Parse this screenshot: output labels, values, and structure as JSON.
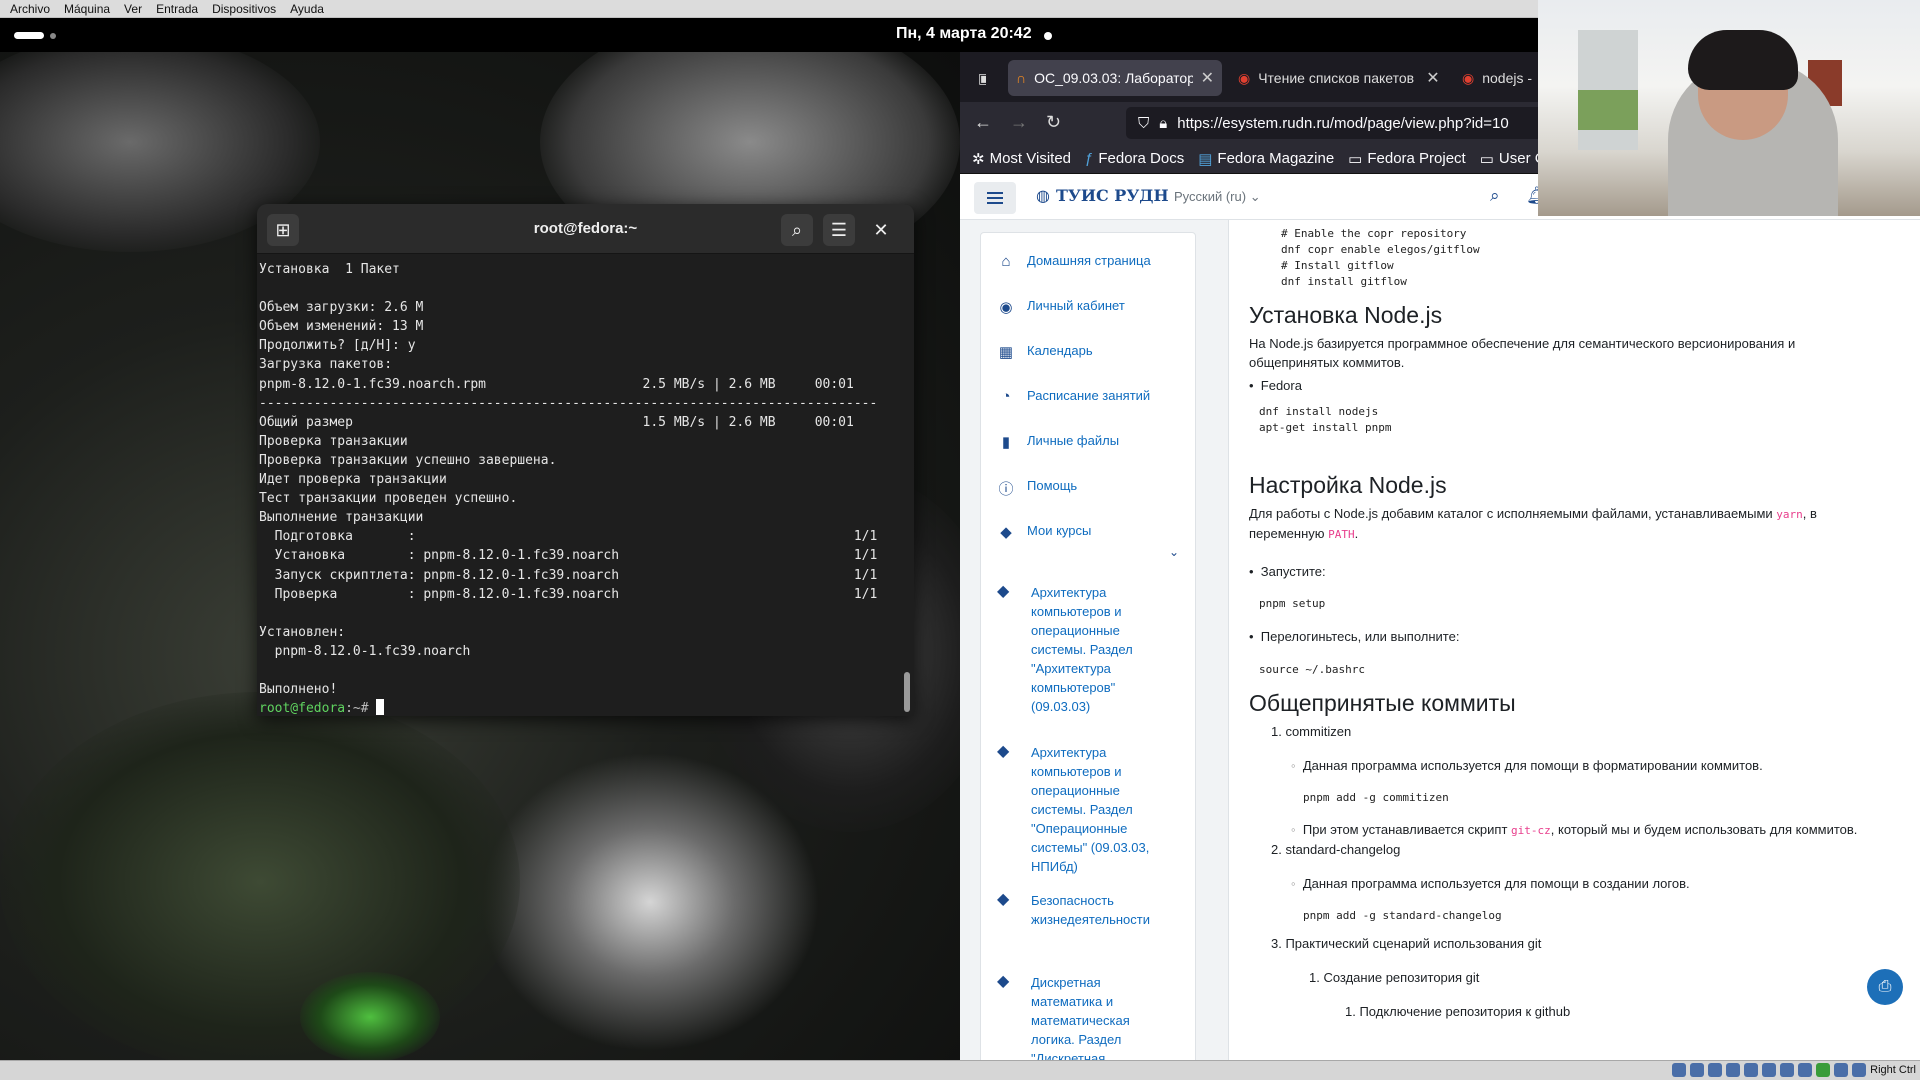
{
  "host_menu": [
    "Archivo",
    "Máquina",
    "Ver",
    "Entrada",
    "Dispositivos",
    "Ayuda"
  ],
  "topbar": {
    "clock": "Пн, 4 марта  20:42"
  },
  "terminal": {
    "title": "root@fedora:~",
    "lines": [
      "Установка  1 Пакет",
      "",
      "Объем загрузки: 2.6 M",
      "Объем изменений: 13 M",
      "Продолжить? [д/Н]: y",
      "Загрузка пакетов:",
      "pnpm-8.12.0-1.fc39.noarch.rpm                    2.5 MB/s | 2.6 MB     00:01",
      "-------------------------------------------------------------------------------",
      "Общий размер                                     1.5 MB/s | 2.6 MB     00:01",
      "Проверка транзакции",
      "Проверка транзакции успешно завершена.",
      "Идет проверка транзакции",
      "Тест транзакции проведен успешно.",
      "Выполнение транзакции",
      "  Подготовка       :                                                        1/1",
      "  Установка        : pnpm-8.12.0-1.fc39.noarch                              1/1",
      "  Запуск скриптлета: pnpm-8.12.0-1.fc39.noarch                              1/1",
      "  Проверка         : pnpm-8.12.0-1.fc39.noarch                              1/1",
      "",
      "Установлен:",
      "  pnpm-8.12.0-1.fc39.noarch",
      "",
      "Выполнено!"
    ],
    "prompt_user": "root@fedora",
    "prompt_rest": ":~# "
  },
  "browser": {
    "tabs": [
      "ОС_09.03.03: Лаборатор",
      "Чтение списков пакетов",
      "nodejs -"
    ],
    "url": "https://esystem.rudn.ru/mod/page/view.php?id=10",
    "bookmarks": [
      "Most Visited",
      "Fedora Docs",
      "Fedora Magazine",
      "Fedora Project",
      "User Co"
    ]
  },
  "site": {
    "brand": "ТУИС РУДН",
    "lang": "Русский (ru)",
    "sidebar": [
      {
        "label": "Домашняя страница",
        "icon": "home-icon"
      },
      {
        "label": "Личный кабинет",
        "icon": "user-icon"
      },
      {
        "label": "Календарь",
        "icon": "calendar-icon"
      },
      {
        "label": "Расписание занятий",
        "icon": "clock-icon"
      },
      {
        "label": "Личные файлы",
        "icon": "file-icon"
      },
      {
        "label": "Помощь",
        "icon": "info-icon"
      },
      {
        "label": "Мои курсы",
        "icon": "graduation-cap-icon"
      }
    ],
    "courses": [
      [
        "Архитектура",
        "компьютеров и",
        "операционные",
        "системы. Раздел",
        "\"Архитектура",
        "компьютеров\"",
        "(09.03.03)"
      ],
      [
        "Архитектура",
        "компьютеров и",
        "операционные",
        "системы. Раздел",
        "\"Операционные",
        "системы\" (09.03.03,",
        "НПИбд)"
      ],
      [
        "Безопасность",
        "жизнедеятельности"
      ],
      [
        "Дискретная",
        "математика и",
        "математическая",
        "логика. Раздел",
        "\"Дискретная"
      ]
    ],
    "content": {
      "code1": [
        "# Enable the copr repository",
        "dnf copr enable elegos/gitflow",
        "# Install gitflow",
        "dnf install gitflow"
      ],
      "h_install": "Установка Node.js",
      "p_install": [
        "На Node.js базируется программное обеспечение для семантического версионирования и",
        "общепринятых коммитов."
      ],
      "fedora": "Fedora",
      "code2": [
        "dnf install nodejs",
        "apt-get install pnpm"
      ],
      "h_setup": "Настройка Node.js",
      "p_setup_a": "Для работы с Node.js добавим каталог с исполняемыми файлами, устанавливаемыми ",
      "p_setup_yarn": "yarn",
      "p_setup_b": ", в",
      "p_setup_c": "переменную ",
      "p_setup_path": "PATH",
      "p_setup_d": ".",
      "run": "Запустите:",
      "code3": "pnpm setup",
      "relogin": "Перелогиньтесь, или выполните:",
      "code4": "source ~/.bashrc",
      "h_commits": "Общепринятые коммиты",
      "li1": "1. commitizen",
      "li1_a": "Данная программа используется для помощи в форматировании коммитов.",
      "code5": "pnpm add -g commitizen",
      "li1_b1": "При этом устанавливается скрипт ",
      "li1_b_code": "git-cz",
      "li1_b2": ", который мы и будем использовать для коммитов.",
      "li2": "2. standard-changelog",
      "li2_a": "Данная программа используется для помощи в создании логов.",
      "code6": "pnpm add -g standard-changelog",
      "li3": "3. Практический сценарий использования git",
      "li3_1": "1. Создание репозитория git",
      "li3_1_1": "1. Подключение репозитория к github"
    }
  },
  "tray": {
    "right_ctrl": "Right Ctrl"
  },
  "colors": {
    "link": "#0f6cbf",
    "brand": "#1d4a8c",
    "prompt": "#5fd35f",
    "inline_code": "#e83e8c"
  }
}
